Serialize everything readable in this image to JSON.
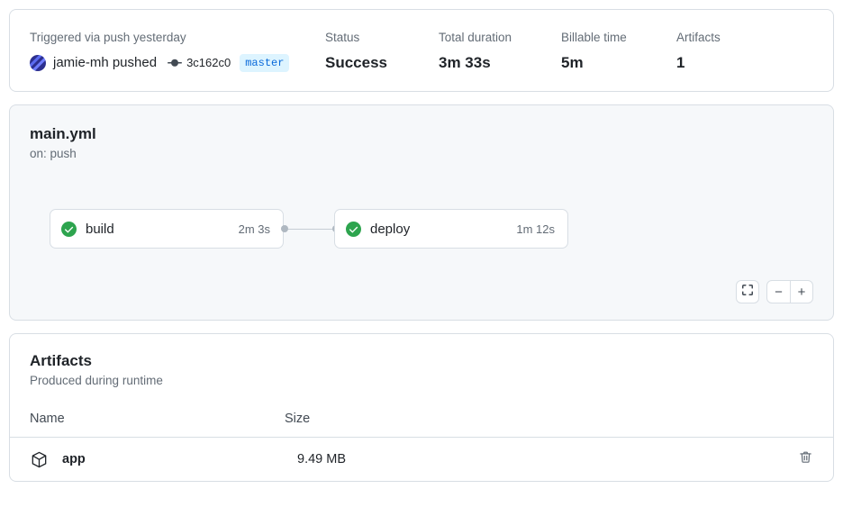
{
  "summary": {
    "trigger": {
      "label": "Triggered via push yesterday",
      "actor": "jamie-mh pushed",
      "commit_icon": "git-commit-icon",
      "commit_sha": "3c162c0",
      "branch": "master"
    },
    "status": {
      "label": "Status",
      "value": "Success"
    },
    "total_duration": {
      "label": "Total duration",
      "value": "3m 33s"
    },
    "billable_time": {
      "label": "Billable time",
      "value": "5m"
    },
    "artifacts_count": {
      "label": "Artifacts",
      "value": "1"
    }
  },
  "workflow": {
    "title": "main.yml",
    "trigger_event": "on: push",
    "nodes": [
      {
        "name": "build",
        "duration": "2m 3s",
        "status_icon": "success-check-icon"
      },
      {
        "name": "deploy",
        "duration": "1m 12s",
        "status_icon": "success-check-icon"
      }
    ],
    "controls": {
      "fit_view_icon": "fullscreen-icon",
      "zoom_out_label": "−",
      "zoom_in_label": "+"
    }
  },
  "artifacts": {
    "title": "Artifacts",
    "subtitle": "Produced during runtime",
    "columns": {
      "name": "Name",
      "size": "Size"
    },
    "rows": [
      {
        "icon": "package-icon",
        "name": "app",
        "size": "9.49 MB",
        "delete_icon": "trash-icon"
      }
    ]
  },
  "colors": {
    "success_green": "#2da44e",
    "branch_badge_bg": "#ddf4ff",
    "branch_badge_fg": "#0969da",
    "card_border": "#d8dee4",
    "graph_bg": "#f6f8fa",
    "muted_text": "#636c76"
  }
}
